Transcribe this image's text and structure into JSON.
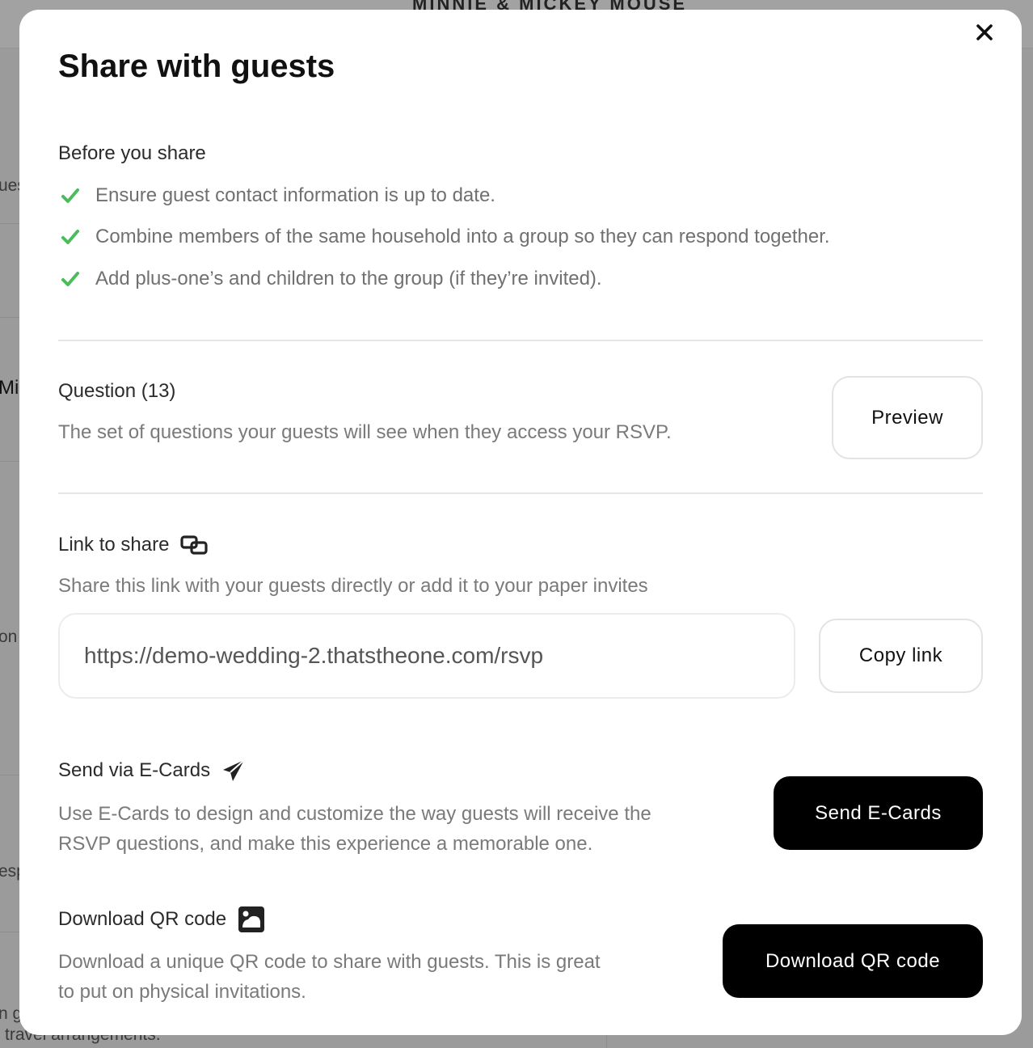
{
  "background": {
    "couple_name": "MINNIE & MICKEY MOUSE",
    "fragments": [
      "ues",
      "Mi",
      "on",
      "esp",
      "n g",
      "travel arrangements."
    ]
  },
  "modal": {
    "title": "Share with guests",
    "close_icon": "close-icon",
    "before": {
      "label": "Before you share",
      "items": [
        "Ensure guest contact information is up to date.",
        "Combine members of the same household into a group so they can respond together.",
        "Add plus-one’s and children to the group (if they’re invited)."
      ],
      "check_color": "#4cbb5c"
    },
    "questions": {
      "label": "Question (13)",
      "description": "The set of questions your guests will see when they access your RSVP.",
      "preview_label": "Preview"
    },
    "link": {
      "label": "Link to share",
      "icon": "link-icon",
      "description": "Share this link with your guests directly or add it to your paper invites",
      "url": "https://demo-wedding-2.thatstheone.com/rsvp",
      "copy_label": "Copy link"
    },
    "ecards": {
      "label": "Send via E-Cards",
      "icon": "paper-plane-icon",
      "description_1": "Use E-Cards to design and customize the way guests will receive the",
      "description_2": "RSVP questions, and make this experience a memorable one.",
      "button_label": "Send E-Cards"
    },
    "qr": {
      "label": "Download QR code",
      "icon": "image-icon",
      "description_1": "Download a unique QR code to share with guests. This is great",
      "description_2": "to put on physical invitations.",
      "button_label": "Download QR code"
    }
  }
}
